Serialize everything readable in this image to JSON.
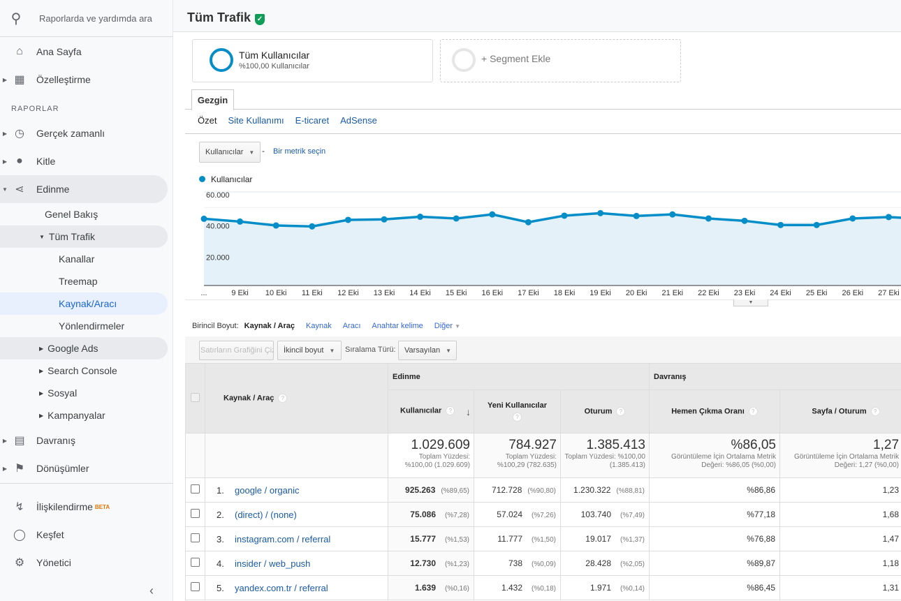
{
  "sidebar": {
    "search_placeholder": "Raporlarda ve yardımda ara",
    "home": "Ana Sayfa",
    "customization": "Özelleştirme",
    "section_reports": "RAPORLAR",
    "realtime": "Gerçek zamanlı",
    "audience": "Kitle",
    "acquisition": "Edinme",
    "overview": "Genel Bakış",
    "all_traffic": "Tüm Trafik",
    "channels": "Kanallar",
    "treemap": "Treemap",
    "source_medium": "Kaynak/Aracı",
    "referrals": "Yönlendirmeler",
    "google_ads": "Google Ads",
    "search_console": "Search Console",
    "social": "Sosyal",
    "campaigns": "Kampanyalar",
    "behavior": "Davranış",
    "conversions": "Dönüşümler",
    "attribution": "İlişkilendirme",
    "beta": "BETA",
    "discover": "Keşfet",
    "admin": "Yönetici"
  },
  "header": {
    "title": "Tüm Trafik"
  },
  "segments": {
    "all_users": "Tüm Kullanıcılar",
    "all_users_sub": "%100,00 Kullanıcılar",
    "add_segment": "+ Segment Ekle"
  },
  "tabs": {
    "explorer": "Gezgin",
    "subtabs": [
      "Özet",
      "Site Kullanımı",
      "E-ticaret",
      "AdSense"
    ]
  },
  "chart_controls": {
    "metric": "Kullanıcılar",
    "separator": "-",
    "pick_metric": "Bir metrik seçin"
  },
  "chart_data": {
    "type": "area",
    "series": [
      {
        "name": "Kullanıcılar",
        "color": "#058dc7",
        "values": [
          42800,
          41000,
          38500,
          37900,
          42100,
          42400,
          44100,
          43000,
          45600,
          40600,
          44800,
          46400,
          44600,
          45600,
          43000,
          41500,
          38800,
          38800,
          43000,
          43900,
          42700
        ]
      }
    ],
    "categories": [
      "...",
      "9 Eki",
      "10 Eki",
      "11 Eki",
      "12 Eki",
      "13 Eki",
      "14 Eki",
      "15 Eki",
      "16 Eki",
      "17 Eki",
      "18 Eki",
      "19 Eki",
      "20 Eki",
      "21 Eki",
      "22 Eki",
      "23 Eki",
      "24 Eki",
      "25 Eki",
      "26 Eki",
      "27 Eki",
      ""
    ],
    "yticks": [
      "20.000",
      "40.000",
      "60.000"
    ],
    "ylim": [
      0,
      60000
    ],
    "grid": true,
    "legend": "top-left"
  },
  "dimensions": {
    "label": "Birincil Boyut:",
    "current": "Kaynak / Araç",
    "options": [
      "Kaynak",
      "Aracı",
      "Anahtar kelime",
      "Diğer"
    ]
  },
  "toolbar": {
    "plot_rows": "Satırların Grafiğini Çiz",
    "secondary": "İkincil boyut",
    "sort_label": "Sıralama Türü:",
    "sort_value": "Varsayılan"
  },
  "table": {
    "dim_header": "Kaynak / Araç",
    "group_acq": "Edinme",
    "group_beh": "Davranış",
    "cols": [
      "Kullanıcılar",
      "Yeni Kullanıcılar",
      "Oturum",
      "Hemen Çıkma Oranı",
      "Sayfa / Oturum"
    ],
    "totals": [
      {
        "value": "1.029.609",
        "note": "Toplam Yüzdesi: %100,00 (1.029.609)"
      },
      {
        "value": "784.927",
        "note": "Toplam Yüzdesi: %100,29 (782.635)"
      },
      {
        "value": "1.385.413",
        "note": "Toplam Yüzdesi: %100,00 (1.385.413)"
      },
      {
        "value": "%86,05",
        "note": "Görüntüleme İçin Ortalama Metrik Değeri: %86,05 (%0,00)"
      },
      {
        "value": "1,27",
        "note": "Görüntüleme İçin Ortalama Metrik Değeri: 1,27 (%0,00)"
      }
    ],
    "rows": [
      {
        "n": "1.",
        "dim": "google / organic",
        "users": "925.263",
        "users_p": "(%89,65)",
        "new": "712.728",
        "new_p": "(%90,80)",
        "sess": "1.230.322",
        "sess_p": "(%88,81)",
        "bounce": "%86,86",
        "pps": "1,23"
      },
      {
        "n": "2.",
        "dim": "(direct) / (none)",
        "users": "75.086",
        "users_p": "(%7,28)",
        "new": "57.024",
        "new_p": "(%7,26)",
        "sess": "103.740",
        "sess_p": "(%7,49)",
        "bounce": "%77,18",
        "pps": "1,68"
      },
      {
        "n": "3.",
        "dim": "instagram.com / referral",
        "users": "15.777",
        "users_p": "(%1,53)",
        "new": "11.777",
        "new_p": "(%1,50)",
        "sess": "19.017",
        "sess_p": "(%1,37)",
        "bounce": "%76,88",
        "pps": "1,47"
      },
      {
        "n": "4.",
        "dim": "insider / web_push",
        "users": "12.730",
        "users_p": "(%1,23)",
        "new": "738",
        "new_p": "(%0,09)",
        "sess": "28.428",
        "sess_p": "(%2,05)",
        "bounce": "%89,87",
        "pps": "1,18"
      },
      {
        "n": "5.",
        "dim": "yandex.com.tr / referral",
        "users": "1.639",
        "users_p": "(%0,16)",
        "new": "1.432",
        "new_p": "(%0,18)",
        "sess": "1.971",
        "sess_p": "(%0,14)",
        "bounce": "%86,45",
        "pps": "1,31"
      }
    ]
  }
}
